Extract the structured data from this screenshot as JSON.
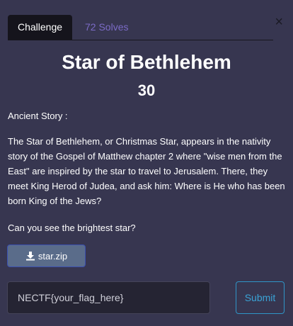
{
  "modal": {
    "close_label": "×"
  },
  "tabs": [
    {
      "label": "Challenge"
    },
    {
      "label": "72 Solves"
    }
  ],
  "challenge": {
    "name": "Star of Bethlehem",
    "points": "30",
    "description": [
      "Ancient Story :",
      "The Star of Bethlehem, or Christmas Star, appears in the nativity story of the Gospel of Matthew chapter 2 where \"wise men from the East\" are inspired by the star to travel to Jerusalem. There, they meet King Herod of Judea, and ask him: Where is He who has been born King of the Jews?",
      "Can you see the brightest star?"
    ],
    "file_label": "star.zip"
  },
  "flag_form": {
    "placeholder": "NECTF{your_flag_here}",
    "submit_label": "Submit"
  },
  "icons": {
    "download": "download-icon",
    "close": "close-icon"
  },
  "colors": {
    "background": "#373650",
    "tab_active": "#15141c",
    "solves_link": "#7b6bc6",
    "download_button": "#5a6c8a",
    "submit_accent": "#2f95c7"
  }
}
